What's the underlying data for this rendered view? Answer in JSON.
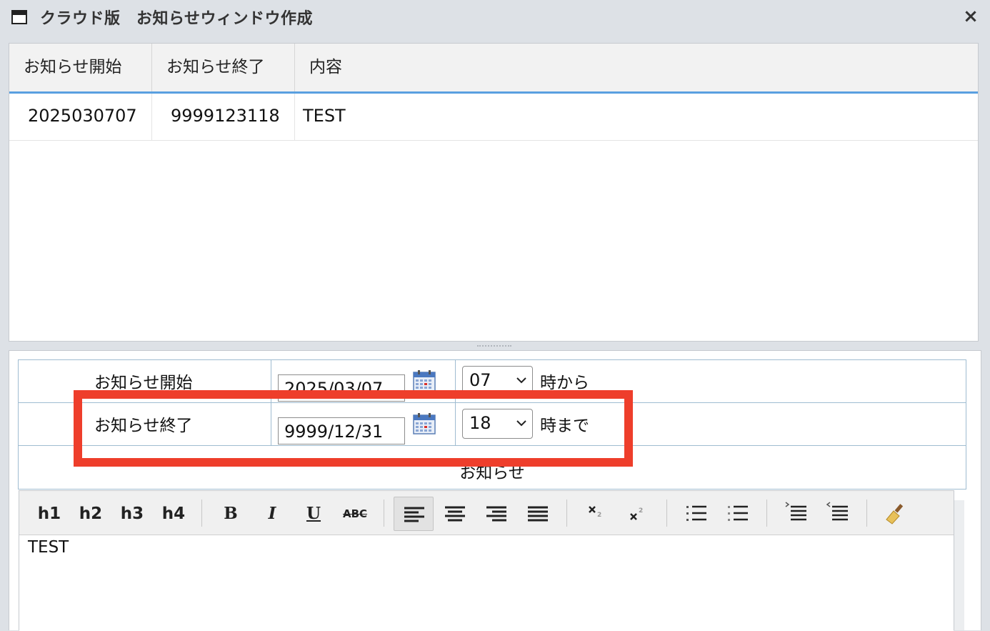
{
  "window": {
    "title": "クラウド版　お知らせウィンドウ作成",
    "close_glyph": "×"
  },
  "grid": {
    "columns": [
      "お知らせ開始",
      "お知らせ終了",
      "内容"
    ],
    "rows": [
      {
        "start": "2025030707",
        "end": "9999123118",
        "content": "TEST"
      }
    ]
  },
  "form": {
    "start": {
      "label": "お知らせ開始",
      "date": "2025/03/07",
      "hour": "07",
      "suffix": "時から"
    },
    "end": {
      "label": "お知らせ終了",
      "date": "9999/12/31",
      "hour": "18",
      "suffix": "時まで"
    },
    "content_label": "お知らせ"
  },
  "editor": {
    "toolbar": {
      "h1": "h1",
      "h2": "h2",
      "h3": "h3",
      "h4": "h4",
      "bold": "B",
      "italic": "I",
      "underline": "U",
      "strike": "ABC",
      "icons": [
        "align-left-icon",
        "align-center-icon",
        "align-right-icon",
        "align-justify-icon",
        "subscript-icon",
        "superscript-icon",
        "ordered-list-icon",
        "unordered-list-icon",
        "indent-icon",
        "outdent-icon",
        "clear-format-icon"
      ]
    },
    "body_text": "TEST"
  },
  "colors": {
    "highlight": "#ee3e2b",
    "header_underline": "#5aa0e0",
    "border": "#9fbcd1"
  }
}
